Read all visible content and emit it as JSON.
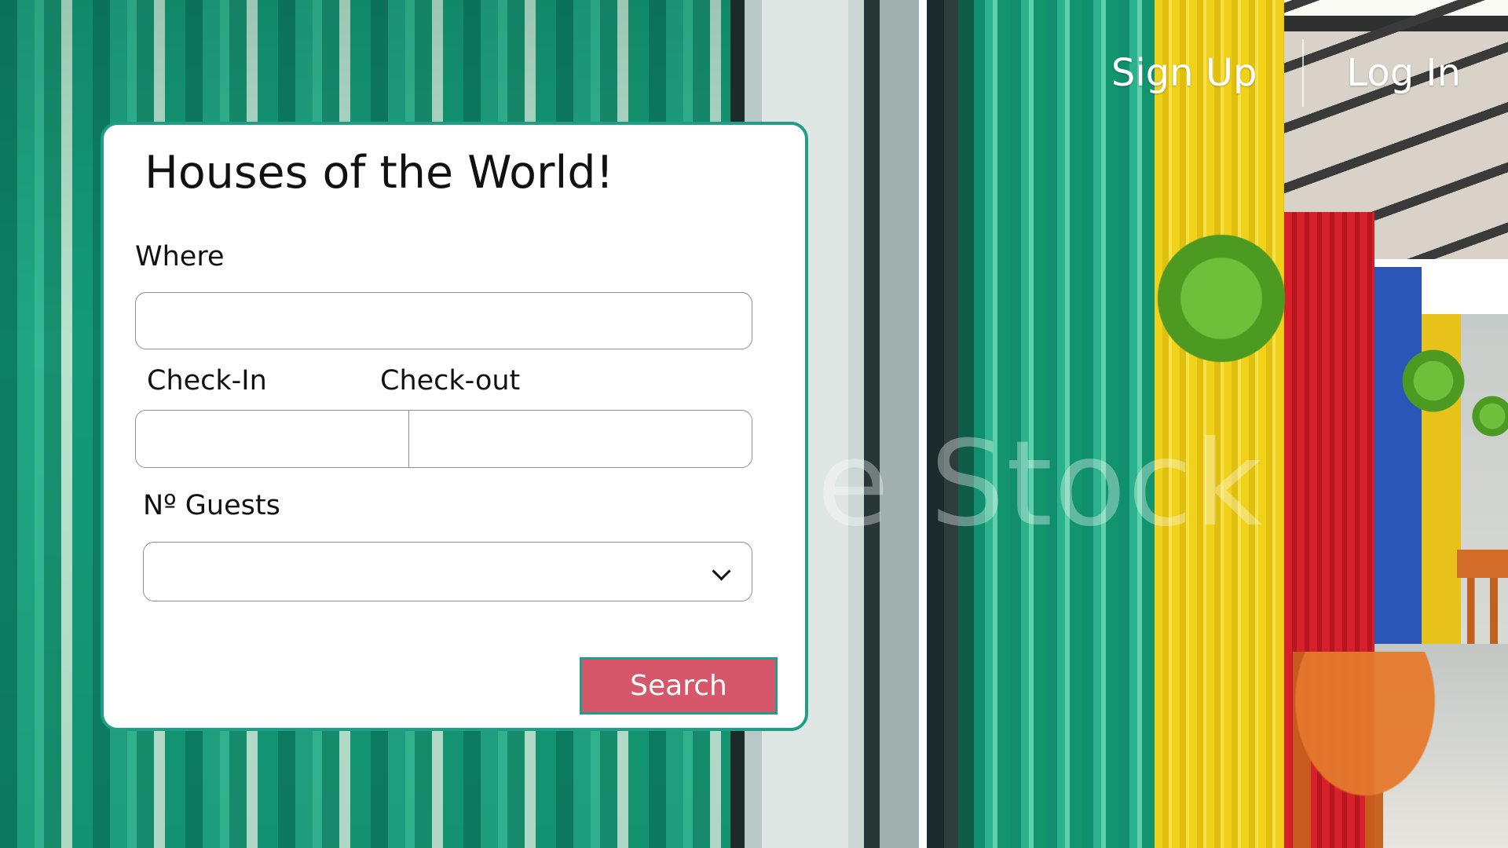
{
  "nav": {
    "signup_label": "Sign Up",
    "login_label": "Log In"
  },
  "background": {
    "watermark_text": "e Stock"
  },
  "search_card": {
    "title": "Houses of the World!",
    "where_label": "Where",
    "where_value": "",
    "checkin_label": "Check-In",
    "checkin_value": "",
    "checkout_label": "Check-out",
    "checkout_value": "",
    "guests_label": "Nº Guests",
    "guests_selected": "",
    "search_label": "Search"
  },
  "colors": {
    "card_border": "#1f9e87",
    "search_button": "#d6576a",
    "nav_text": "#ffffff"
  },
  "icons": {
    "guests_dropdown": "chevron-down-icon"
  }
}
